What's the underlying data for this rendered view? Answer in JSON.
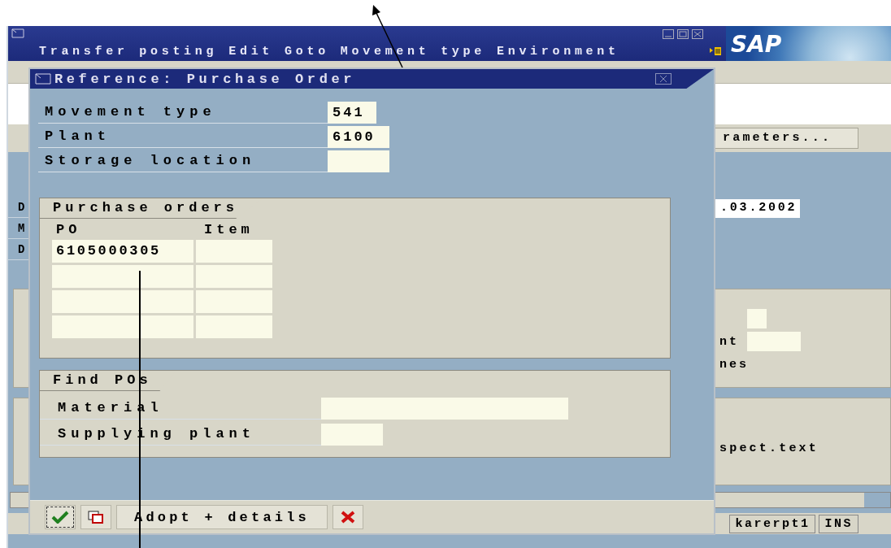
{
  "window": {
    "menu": [
      {
        "label": "Transfer posting"
      },
      {
        "label": "Edit"
      },
      {
        "label": "Goto"
      },
      {
        "label": "Movement type"
      },
      {
        "label": "Environment"
      }
    ],
    "logo": "SAP"
  },
  "background": {
    "left_labels": [
      "D",
      "M",
      "D"
    ],
    "button": "rameters...",
    "date": ".03.2002",
    "label_1": "nt",
    "label_2": "nes",
    "text": "spect.text"
  },
  "status_bar": {
    "client": "karerpt1",
    "mode": "INS"
  },
  "dialog": {
    "title": "Reference: Purchase Order",
    "fields": [
      {
        "label": "Movement type",
        "value": "541",
        "kind": "short"
      },
      {
        "label": "Plant",
        "value": "6100",
        "kind": "medium"
      },
      {
        "label": "Storage location",
        "kind": "medium"
      }
    ],
    "po_group": {
      "title": "Purchase orders",
      "columns": [
        "PO",
        "Item"
      ],
      "rows": [
        {
          "kind": "filled",
          "po": "6105000305"
        },
        {
          "kind": "empty"
        },
        {
          "kind": "empty"
        },
        {
          "kind": "empty"
        }
      ]
    },
    "find_group": {
      "title": "Find POs",
      "fields": [
        {
          "label": "Material",
          "kind": "long"
        },
        {
          "label": "Supplying plant",
          "kind": "medium"
        }
      ]
    },
    "buttons": [
      {
        "kind": "confirm",
        "focused": true
      },
      {
        "kind": "copy",
        "focused": false
      },
      {
        "kind": "text",
        "label": "Adopt + details",
        "focused": false
      },
      {
        "kind": "cancel",
        "focused": false
      }
    ]
  }
}
